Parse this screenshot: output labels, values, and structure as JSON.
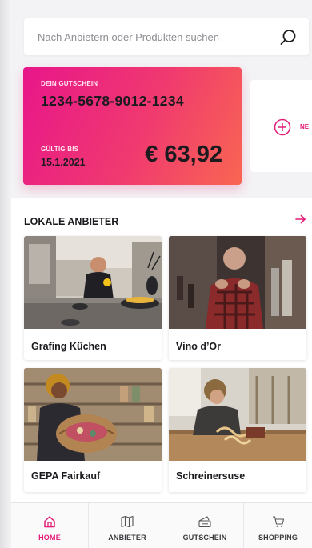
{
  "search": {
    "placeholder": "Nach Anbietern oder Produkten suchen",
    "icon": "search-icon"
  },
  "voucher": {
    "label": "DEIN GUTSCHEIN",
    "code": "1234-5678-9012-1234",
    "valid_label": "GÜLTIG BIS",
    "valid_date": "15.1.2021",
    "amount": "€ 63,92",
    "gradient_start": "#e8168a",
    "gradient_end": "#f96652"
  },
  "new_voucher": {
    "label": "NE",
    "icon": "plus-circle-icon"
  },
  "section": {
    "title": "LOKALE ANBIETER",
    "arrow_icon": "arrow-right-icon"
  },
  "providers": [
    {
      "name": "Grafing Küchen"
    },
    {
      "name": "Vino d’Or"
    },
    {
      "name": "GEPA Fairkauf"
    },
    {
      "name": "Schreinersuse"
    }
  ],
  "nav": {
    "items": [
      {
        "label": "HOME",
        "icon": "home-icon",
        "active": true
      },
      {
        "label": "ANBIETER",
        "icon": "map-icon",
        "active": false
      },
      {
        "label": "GUTSCHEIN",
        "icon": "ticket-icon",
        "active": false
      },
      {
        "label": "SHOPPING",
        "icon": "cart-icon",
        "active": false
      }
    ]
  },
  "colors": {
    "accent": "#e21c77",
    "background": "#f3f3f5"
  }
}
